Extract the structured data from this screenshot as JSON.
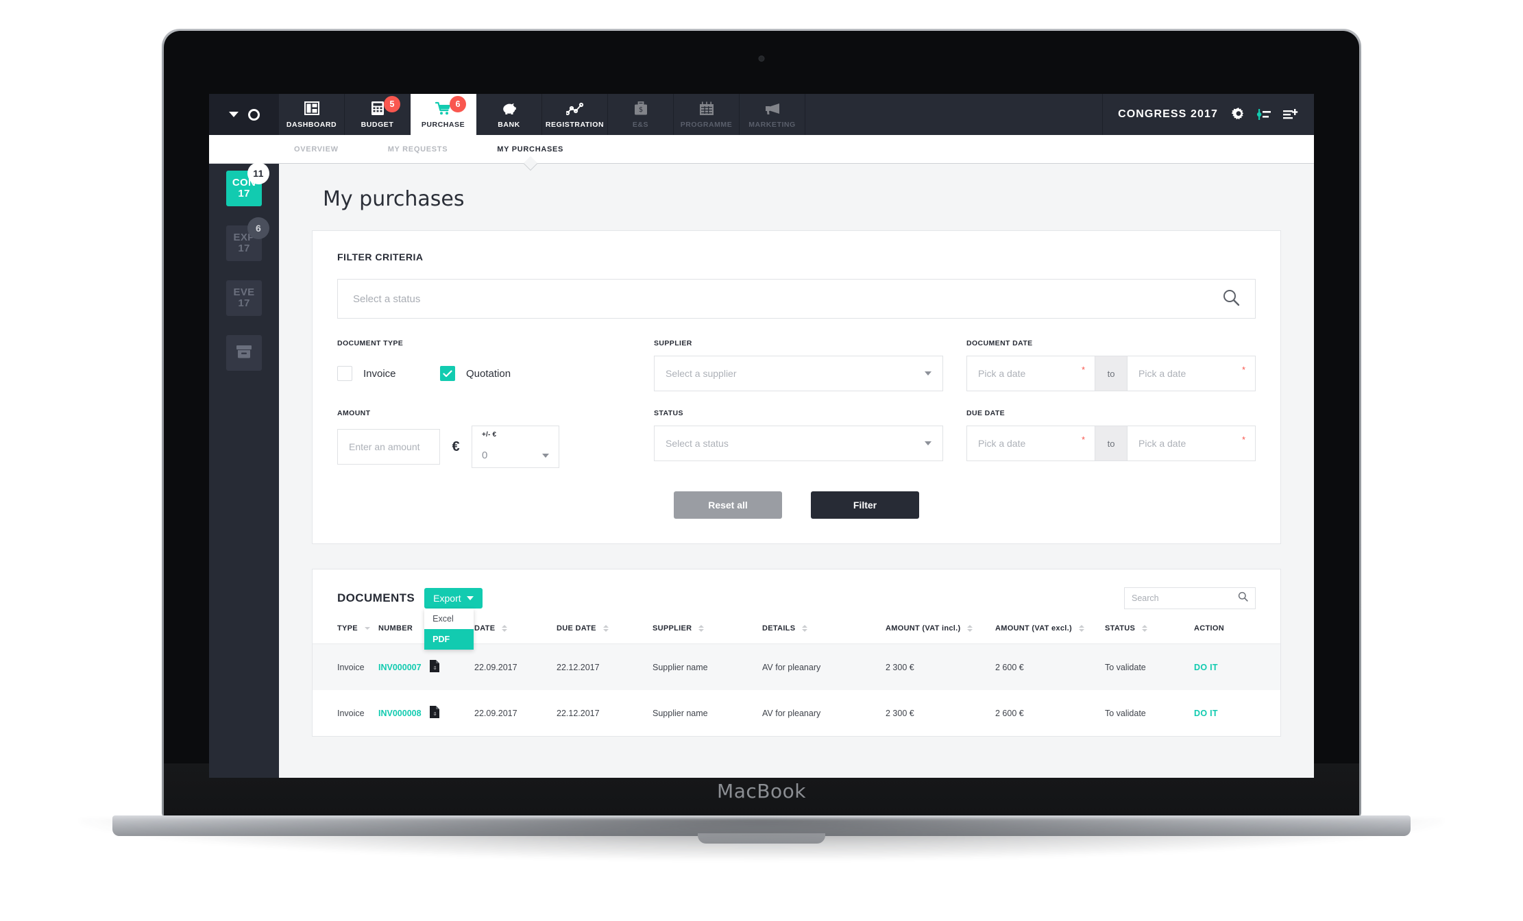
{
  "device": {
    "logo": "MacBook"
  },
  "topnav": {
    "items": [
      {
        "label": "DASHBOARD",
        "icon": "dashboard-icon",
        "badge": null,
        "active": false,
        "dim": false
      },
      {
        "label": "BUDGET",
        "icon": "calculator-icon",
        "badge": "5",
        "active": false,
        "dim": false
      },
      {
        "label": "PURCHASE",
        "icon": "shopping-cart-icon",
        "badge": "6",
        "active": true,
        "dim": false
      },
      {
        "label": "BANK",
        "icon": "piggy-bank-icon",
        "badge": null,
        "active": false,
        "dim": false
      },
      {
        "label": "REGISTRATION",
        "icon": "line-chart-icon",
        "badge": null,
        "active": false,
        "dim": false
      },
      {
        "label": "E&S",
        "icon": "briefcase-icon",
        "badge": null,
        "active": false,
        "dim": true
      },
      {
        "label": "PROGRAMME",
        "icon": "calendar-icon",
        "badge": null,
        "active": false,
        "dim": true
      },
      {
        "label": "MARKETING",
        "icon": "megaphone-icon",
        "badge": null,
        "active": false,
        "dim": true
      }
    ],
    "brand_title": "CONGRESS 2017",
    "icons": [
      "gear-icon",
      "settings-sliders-icon",
      "add-list-icon"
    ]
  },
  "subtabs": [
    {
      "label": "OVERVIEW",
      "active": false
    },
    {
      "label": "MY REQUESTS",
      "active": false
    },
    {
      "label": "MY PURCHASES",
      "active": true
    }
  ],
  "sidebar": {
    "items": [
      {
        "line1": "CON",
        "line2": "17",
        "badge": "11",
        "badge_style": "light",
        "active": true
      },
      {
        "line1": "EXP",
        "line2": "17",
        "badge": "6",
        "badge_style": "grey",
        "active": false
      },
      {
        "line1": "EVE",
        "line2": "17",
        "badge": null,
        "badge_style": null,
        "active": false
      },
      {
        "line1": "",
        "line2": "",
        "badge": null,
        "badge_style": null,
        "active": false,
        "icon": "archive-box-icon"
      }
    ]
  },
  "page": {
    "title": "My purchases"
  },
  "filter": {
    "card_title": "FILTER CRITERIA",
    "status_search_placeholder": "Select a status",
    "search_icon": "search-icon",
    "document_type": {
      "label": "DOCUMENT TYPE",
      "options": [
        {
          "label": "Invoice",
          "checked": false
        },
        {
          "label": "Quotation",
          "checked": true
        }
      ]
    },
    "supplier": {
      "label": "SUPPLIER",
      "placeholder": "Select a supplier"
    },
    "document_date": {
      "label": "DOCUMENT DATE",
      "from_placeholder": "Pick a date",
      "separator": "to",
      "to_placeholder": "Pick a date",
      "required_marker": "*"
    },
    "amount": {
      "label": "AMOUNT",
      "placeholder": "Enter an amount",
      "currency": "€",
      "tolerance_label": "+/- €",
      "tolerance_value": "0"
    },
    "status": {
      "label": "STATUS",
      "placeholder": "Select a status"
    },
    "due_date": {
      "label": "DUE DATE",
      "from_placeholder": "Pick a date",
      "separator": "to",
      "to_placeholder": "Pick a date",
      "required_marker": "*"
    },
    "buttons": {
      "reset": "Reset all",
      "filter": "Filter"
    }
  },
  "documents": {
    "title": "DOCUMENTS",
    "export": {
      "label": "Export",
      "options": [
        {
          "label": "Excel",
          "selected": false
        },
        {
          "label": "PDF",
          "selected": true
        }
      ]
    },
    "search_placeholder": "Search",
    "columns": [
      {
        "label": "TYPE",
        "sortable": true
      },
      {
        "label": "NUMBER",
        "sortable": false
      },
      {
        "label": "DATE",
        "sortable": true
      },
      {
        "label": "DUE DATE",
        "sortable": true
      },
      {
        "label": "SUPPLIER",
        "sortable": true
      },
      {
        "label": "DETAILS",
        "sortable": true
      },
      {
        "label": "AMOUNT (VAT incl.)",
        "sortable": true
      },
      {
        "label": "AMOUNT (VAT excl.)",
        "sortable": true
      },
      {
        "label": "STATUS",
        "sortable": true
      },
      {
        "label": "ACTION",
        "sortable": false
      }
    ],
    "rows": [
      {
        "type": "Invoice",
        "number": "INV000007",
        "file_icon": "pdf-file-icon",
        "date": "22.09.2017",
        "due_date": "22.12.2017",
        "supplier": "Supplier name",
        "details": "AV for pleanary",
        "amount_incl": "2 300 €",
        "amount_excl": "2 600 €",
        "status": "To validate",
        "action": "DO IT"
      },
      {
        "type": "Invoice",
        "number": "INV000008",
        "file_icon": "pdf-file-icon",
        "date": "22.09.2017",
        "due_date": "22.12.2017",
        "supplier": "Supplier name",
        "details": "AV for pleanary",
        "amount_incl": "2 300 €",
        "amount_excl": "2 600 €",
        "status": "To validate",
        "action": "DO IT"
      }
    ]
  },
  "colors": {
    "accent_teal": "#12cbb0",
    "dark_navy": "#272b35",
    "badge_red": "#f9574f",
    "page_bg": "#f4f5f6"
  }
}
